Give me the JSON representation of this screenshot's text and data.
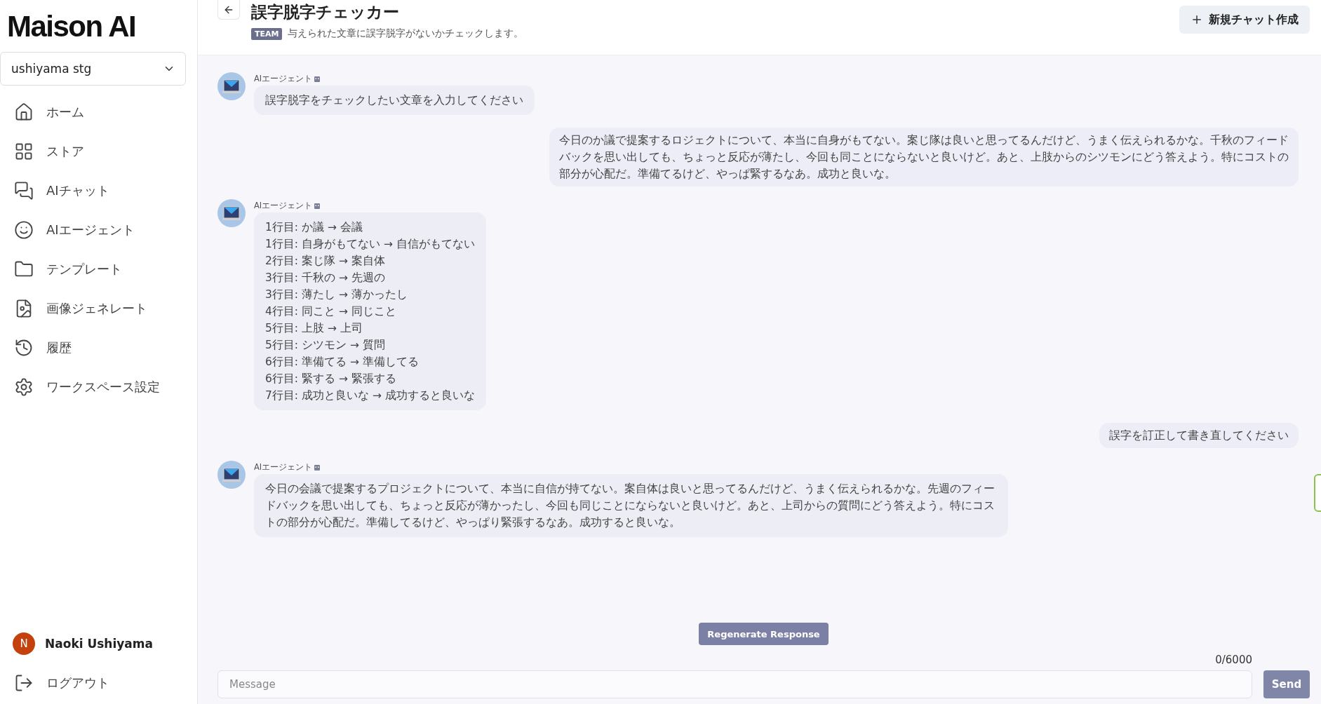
{
  "sidebar": {
    "logo": "Maison AI",
    "workspace": "ushiyama stg",
    "nav": [
      {
        "kind": "home",
        "label": "ホーム"
      },
      {
        "kind": "grid",
        "label": "ストア"
      },
      {
        "kind": "chat",
        "label": "AIチャット"
      },
      {
        "kind": "smile",
        "label": "AIエージェント"
      },
      {
        "kind": "folder",
        "label": "テンプレート"
      },
      {
        "kind": "image",
        "label": "画像ジェネレート"
      },
      {
        "kind": "history",
        "label": "履歴"
      },
      {
        "kind": "settings",
        "label": "ワークスペース設定"
      }
    ],
    "user": {
      "initial": "N",
      "name": "Naoki Ushiyama"
    },
    "logout": "ログアウト"
  },
  "header": {
    "title": "誤字脱字チェッカー",
    "badge": "TEAM",
    "description": "与えられた文章に誤字脱字がないかチェックします。",
    "new_chat": "新規チャット作成"
  },
  "messages": [
    {
      "kind": "agent",
      "sender": "AIエージェント",
      "lines": [
        "誤字脱字をチェックしたい文章を入力してください"
      ]
    },
    {
      "kind": "user",
      "lines": [
        "今日のか議で提案するロジェクトについて、本当に自身がもてない。案じ隊は良いと思ってるんだけど、うまく伝えられるかな。千秋のフィードバックを思い出しても、ちょっと反応が薄たし、今回も同ことにならないと良いけど。あと、上肢からのシツモンにどう答えよう。特にコストの部分が心配だ。準備てるけど、やっぱ緊するなあ。成功と良いな。"
      ]
    },
    {
      "kind": "agent",
      "sender": "AIエージェント",
      "lines": [
        "1行目: か議 → 会議",
        "1行目: 自身がもてない → 自信がもてない",
        "2行目: 案じ隊 → 案自体",
        "3行目: 千秋の → 先週の",
        "3行目: 薄たし → 薄かったし",
        "4行目: 同こと → 同じこと",
        "5行目: 上肢 → 上司",
        "5行目: シツモン → 質問",
        "6行目: 準備てる → 準備してる",
        "6行目: 緊する → 緊張する",
        "7行目: 成功と良いな → 成功すると良いな"
      ]
    },
    {
      "kind": "user",
      "lines": [
        "誤字を訂正して書き直してください"
      ]
    },
    {
      "kind": "agent",
      "sender": "AIエージェント",
      "lines": [
        "今日の会議で提案するプロジェクトについて、本当に自信が持てない。案自体は良いと思ってるんだけど、うまく伝えられるかな。先週のフィードバックを思い出しても、ちょっと反応が薄かったし、今回も同じことにならないと良いけど。あと、上司からの質問にどう答えよう。特にコストの部分が心配だ。準備してるけど、やっぱり緊張するなあ。成功すると良いな。"
      ]
    }
  ],
  "regenerate": "Regenerate Response",
  "counter": "0/6000",
  "input": {
    "placeholder": "Message"
  },
  "send": "Send"
}
